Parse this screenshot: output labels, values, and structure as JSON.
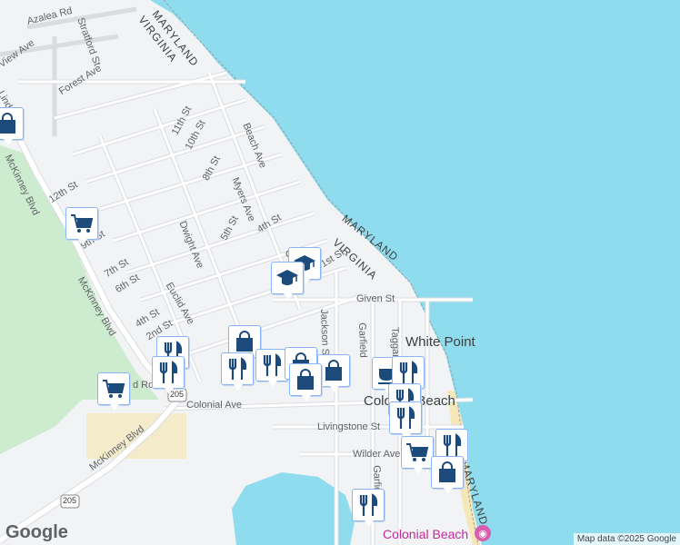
{
  "map": {
    "water_label_states": [
      "MARYLAND",
      "VIRGINIA"
    ],
    "streets": {
      "azalea": "Azalea Rd",
      "stratford": "Stratford St",
      "view": "View Ave",
      "forest": "Forest Ave",
      "linda": "Linda L",
      "st11": "11th St",
      "st10": "10th St",
      "beach": "Beach Ave",
      "st8": "8th St",
      "myers": "Myers Ave",
      "st12": "12th St",
      "dwight": "Dwight Ave",
      "st5": "5th St",
      "st4": "4th St",
      "st9": "9th St",
      "st7": "7th St",
      "st6": "6th St",
      "mckinney1": "McKinney Blvd",
      "mckinney2": "McKinney Blvd",
      "mckinney3": "McKinney Blvd",
      "euclid": "Euclid Ave",
      "st4b": "4th St",
      "st2": "2nd St",
      "st1": "1st St",
      "given": "Given St",
      "jackson": "Jackson St",
      "garfield": "Garfield",
      "taggart": "Taggart",
      "colonial_ave": "Colonial Ave",
      "livingstone": "Livingstone St",
      "wilder": "Wilder Ave",
      "garfield2": "Garfie",
      "rd": "d Rd",
      "route205a": "205",
      "route205b": "205",
      "c_st": "C"
    },
    "towns": {
      "white_point": "White Point",
      "colonial_beach": "Colonial Beach"
    },
    "poi": {
      "colonial_beach_poi": "Colonial Beach"
    },
    "pins": [
      {
        "type": "shopping-bag",
        "name": "pin-shopping-bag-1"
      },
      {
        "type": "shopping-cart",
        "name": "pin-shopping-cart-1"
      },
      {
        "type": "school",
        "name": "pin-school-1"
      },
      {
        "type": "school",
        "name": "pin-school-2"
      },
      {
        "type": "restaurant",
        "name": "pin-restaurant-1"
      },
      {
        "type": "restaurant",
        "name": "pin-restaurant-2"
      },
      {
        "type": "shopping-cart",
        "name": "pin-shopping-cart-2"
      },
      {
        "type": "shopping-bag",
        "name": "pin-shopping-bag-2"
      },
      {
        "type": "restaurant",
        "name": "pin-restaurant-3"
      },
      {
        "type": "restaurant",
        "name": "pin-restaurant-4"
      },
      {
        "type": "shopping-bag",
        "name": "pin-shopping-bag-3"
      },
      {
        "type": "shopping-bag",
        "name": "pin-shopping-bag-4"
      },
      {
        "type": "shopping-bag",
        "name": "pin-shopping-bag-5"
      },
      {
        "type": "cafe",
        "name": "pin-cafe-1"
      },
      {
        "type": "restaurant",
        "name": "pin-restaurant-5"
      },
      {
        "type": "restaurant",
        "name": "pin-restaurant-6"
      },
      {
        "type": "restaurant",
        "name": "pin-restaurant-7"
      },
      {
        "type": "shopping-cart",
        "name": "pin-shopping-cart-3"
      },
      {
        "type": "restaurant",
        "name": "pin-restaurant-8"
      },
      {
        "type": "shopping-bag",
        "name": "pin-shopping-bag-6"
      },
      {
        "type": "restaurant",
        "name": "pin-restaurant-9"
      }
    ],
    "colors": {
      "water": "#8fdcee",
      "land": "#f1f3f4",
      "park": "#cdeccf",
      "road": "#ffffff",
      "beach": "#f5e7b8",
      "pin_border": "#8ab4f8",
      "icon": "#1c4a7a"
    }
  },
  "footer": {
    "logo": "Google",
    "attribution": "Map data ©2025 Google"
  }
}
